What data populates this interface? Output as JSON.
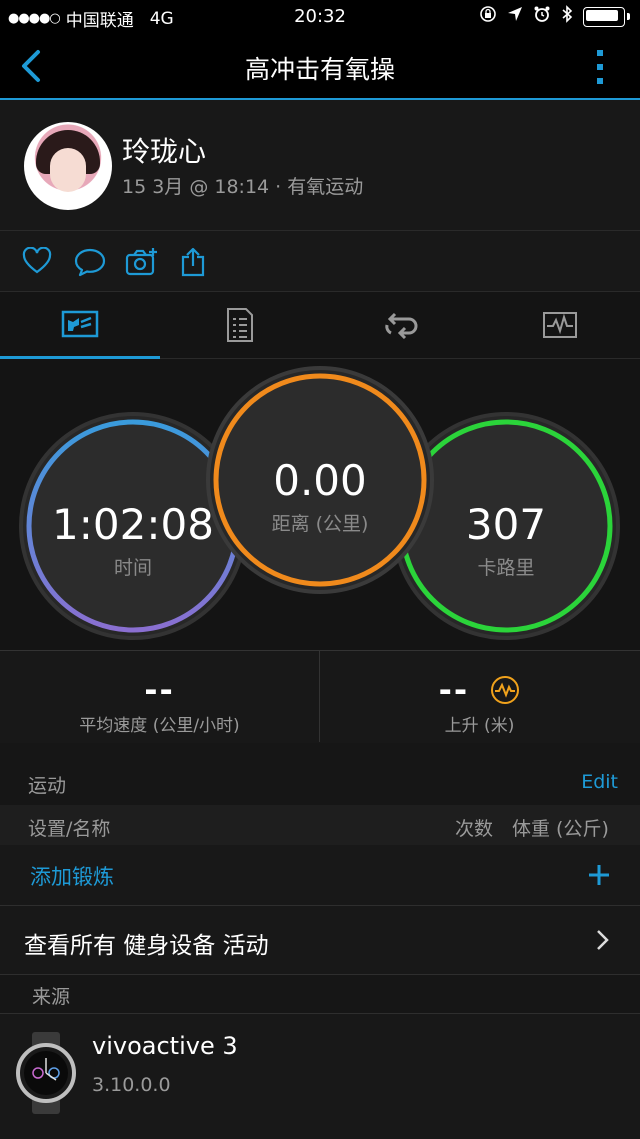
{
  "status_bar": {
    "carrier": "中国联通",
    "network": "4G",
    "time": "20:32"
  },
  "nav": {
    "title": "高冲击有氧操"
  },
  "profile": {
    "name": "玲珑心",
    "meta": "15 3月 @ 18:14 · 有氧运动"
  },
  "rings": [
    {
      "value": "1:02:08",
      "label": "时间",
      "color": "#4a8fdc"
    },
    {
      "value": "0.00",
      "label": "距离 (公里)",
      "color": "#f08a1c"
    },
    {
      "value": "307",
      "label": "卡路里",
      "color": "#2bd43a"
    }
  ],
  "stats": [
    {
      "value": "--",
      "label": "平均速度 (公里/小时)"
    },
    {
      "value": "--",
      "label": "上升 (米)"
    }
  ],
  "exercise": {
    "section_label": "运动",
    "edit_label": "Edit",
    "col_name": "设置/名称",
    "col_reps": "次数",
    "col_weight": "体重 (公斤)",
    "add_label": "添加锻炼"
  },
  "view_all": {
    "label": "查看所有 健身设备 活动"
  },
  "source": {
    "section_label": "来源",
    "device_name": "vivoactive 3",
    "device_version": "3.10.0.0"
  },
  "colors": {
    "accent": "#1e9ad6",
    "background": "#141414"
  },
  "icons": [
    "back-icon",
    "more-icon",
    "heart-icon",
    "comment-icon",
    "camera-add-icon",
    "share-icon",
    "overview-tab-icon",
    "details-tab-icon",
    "laps-tab-icon",
    "chart-tab-icon",
    "elevation-icon",
    "chevron-right-icon",
    "plus-icon",
    "watch-icon"
  ]
}
